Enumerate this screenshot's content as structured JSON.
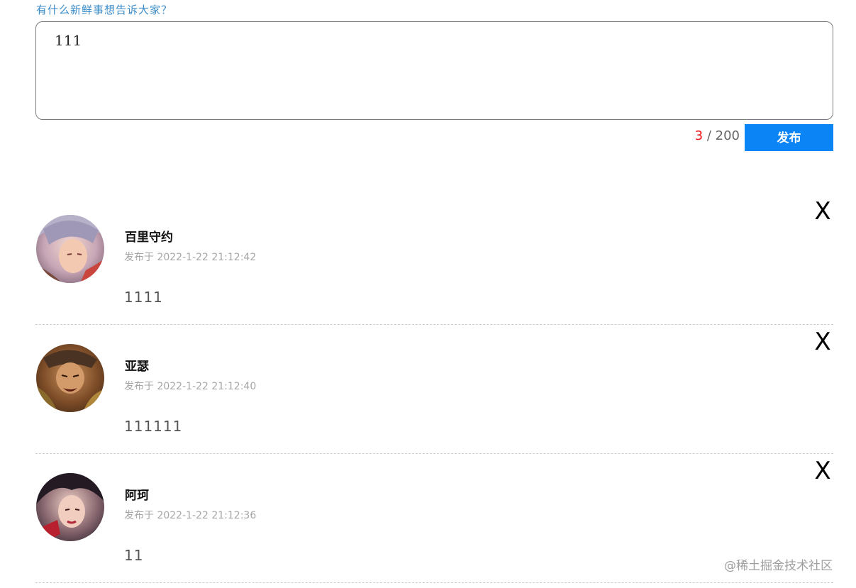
{
  "composer": {
    "prompt": "有什么新鲜事想告诉大家？",
    "value": "111",
    "count": "3",
    "max_label": " / 200",
    "publish_label": "发布"
  },
  "posts": [
    {
      "username": "百里守约",
      "time": "发布于 2022-1-22 21:12:42",
      "content": "1111",
      "delete_label": "X"
    },
    {
      "username": "亚瑟",
      "time": "发布于 2022-1-22 21:12:40",
      "content": "111111",
      "delete_label": "X"
    },
    {
      "username": "阿珂",
      "time": "发布于 2022-1-22 21:12:36",
      "content": "11",
      "delete_label": "X"
    }
  ],
  "watermark": "@稀土掘金技术社区",
  "colors": {
    "accent": "#0b84f6",
    "count_red": "#e11111",
    "prompt_blue": "#3a8cc8"
  }
}
